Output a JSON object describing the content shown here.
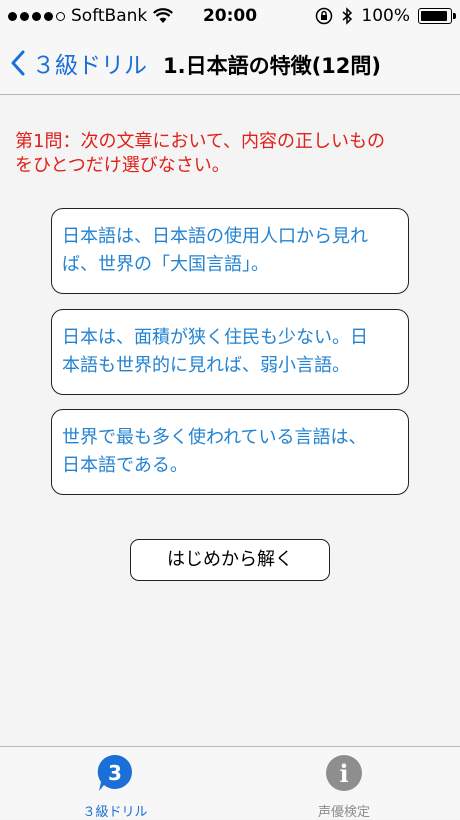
{
  "status": {
    "carrier": "SoftBank",
    "time": "20:00",
    "battery": "100%",
    "battery_level": 1.0
  },
  "nav": {
    "back_label": "３級ドリル",
    "title": "1.日本語の特徴(12問)"
  },
  "question": {
    "line1": "第1問：次の文章において、内容の正しいもの",
    "line2": "をひとつだけ選びなさい。"
  },
  "choices": [
    {
      "line1": "日本語は、日本語の使用人口から見れ",
      "line2": "ば、世界の「大国言語」。"
    },
    {
      "line1": "日本は、面積が狭く住民も少ない。日",
      "line2": "本語も世界的に見れば、弱小言語。"
    },
    {
      "line1": "世界で最も多く使われている言語は、",
      "line2": "日本語である。"
    }
  ],
  "restart_label": "はじめから解く",
  "tabs": [
    {
      "label": "３級ドリル",
      "icon_text": "3"
    },
    {
      "label": "声優検定",
      "icon_text": "i"
    }
  ],
  "colors": {
    "accent": "#1a6fd8",
    "question": "#e0201b",
    "choice_text": "#2483d1"
  }
}
